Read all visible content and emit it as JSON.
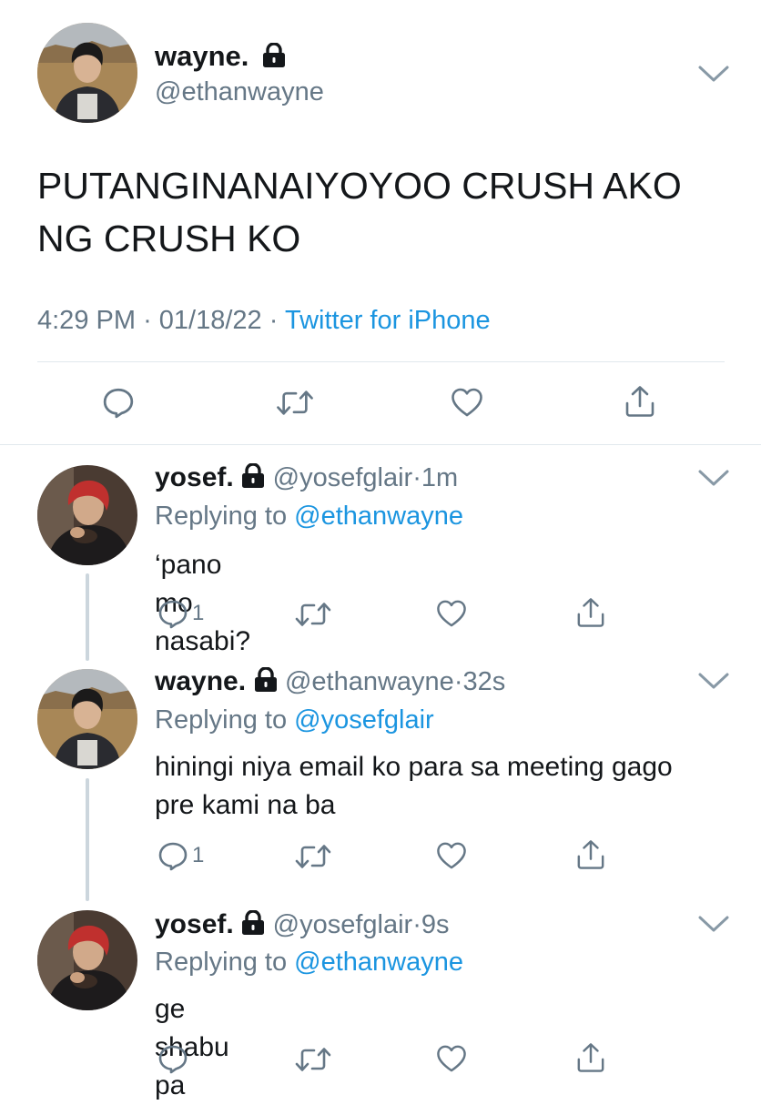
{
  "main_tweet": {
    "author_name": "wayne.",
    "author_handle": "@ethanwayne",
    "text_line1": "PUTANGINANAIYOYOO CRUSH AKO",
    "text_line2": "NG CRUSH KO",
    "time": "4:29 PM",
    "date": "01/18/22",
    "sep": "·",
    "source": "Twitter for iPhone"
  },
  "replies": [
    {
      "name": "yosef.",
      "handle": "@yosefglair",
      "dot": "·",
      "time": "1m",
      "replying_prefix": "Replying to",
      "replying_to": "@ethanwayne",
      "text_line1": "‘pano mo nasabi?",
      "text_line2": "",
      "reply_count": "1"
    },
    {
      "name": "wayne.",
      "handle": "@ethanwayne",
      "dot": "·",
      "time": "32s",
      "replying_prefix": "Replying to",
      "replying_to": "@yosefglair",
      "text_line1": "hiningi niya email ko para sa meeting gago",
      "text_line2": "pre kami na ba",
      "reply_count": "1"
    },
    {
      "name": "yosef.",
      "handle": "@yosefglair",
      "dot": "·",
      "time": "9s",
      "replying_prefix": "Replying to",
      "replying_to": "@ethanwayne",
      "text_line1": "ge shabu pa",
      "text_line2": "",
      "reply_count": ""
    }
  ],
  "icons": {
    "lock": "lock-icon",
    "chevron": "chevron-down-icon",
    "reply": "reply-icon",
    "retweet": "retweet-icon",
    "like": "heart-icon",
    "share": "share-icon"
  },
  "colors": {
    "text": "#14171a",
    "secondary": "#657786",
    "link": "#1b95e0",
    "divider": "#e1e8ed",
    "thread_line": "#ccd6dd"
  }
}
